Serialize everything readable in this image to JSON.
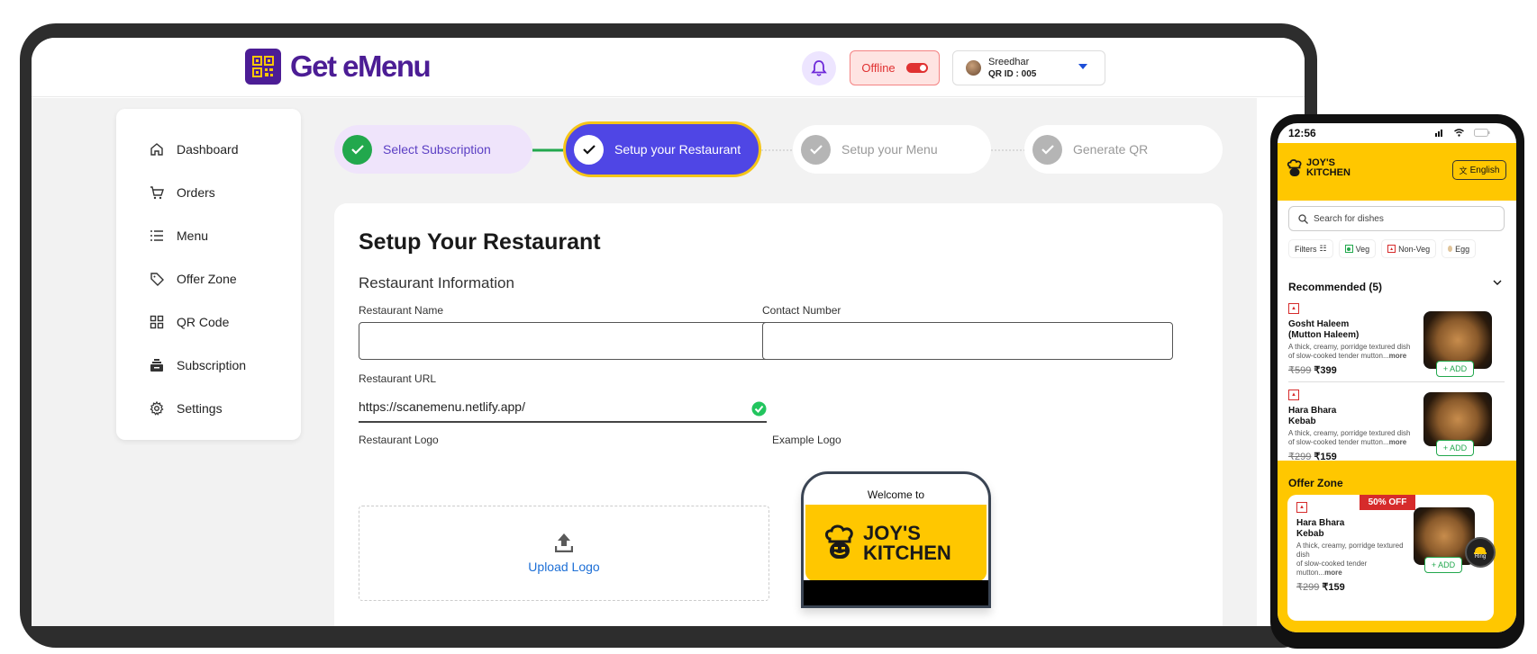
{
  "app": {
    "title": "Get eMenu"
  },
  "header": {
    "status_label": "Offline",
    "user_name": "Sreedhar",
    "user_qr": "QR ID : 005"
  },
  "sidebar": {
    "items": [
      {
        "label": "Dashboard",
        "icon": "home-icon"
      },
      {
        "label": "Orders",
        "icon": "cart-icon"
      },
      {
        "label": "Menu",
        "icon": "list-icon"
      },
      {
        "label": "Offer Zone",
        "icon": "tag-icon"
      },
      {
        "label": "QR Code",
        "icon": "grid-icon"
      },
      {
        "label": "Subscription",
        "icon": "subscription-icon"
      },
      {
        "label": "Settings",
        "icon": "gear-icon"
      }
    ]
  },
  "steps": [
    {
      "label": "Select Subscription",
      "state": "done"
    },
    {
      "label": "Setup your Restaurant",
      "state": "active"
    },
    {
      "label": "Setup your Menu",
      "state": "pending"
    },
    {
      "label": "Generate QR",
      "state": "pending"
    }
  ],
  "form": {
    "title": "Setup Your Restaurant",
    "section": "Restaurant Information",
    "name_label": "Restaurant Name",
    "name_value": "",
    "contact_label": "Contact Number",
    "contact_value": "",
    "url_label": "Restaurant URL",
    "url_value": "https://scanemenu.netlify.app/",
    "logo_label": "Restaurant Logo",
    "upload_label": "Upload Logo",
    "example_label": "Example Logo",
    "example_welcome": "Welcome to",
    "example_name_1": "JOY'S",
    "example_name_2": "KITCHEN"
  },
  "phone": {
    "time": "12:56",
    "brand_1": "JOY'S",
    "brand_2": "KITCHEN",
    "language": "English",
    "search_placeholder": "Search for dishes",
    "filters": [
      "Filters",
      "Veg",
      "Non-Veg",
      "Egg"
    ],
    "recommended": "Recommended (5)",
    "dishes": [
      {
        "name_1": "Gosht Haleem",
        "name_2": "(Mutton Haleem)",
        "desc_1": "A thick, creamy, porridge textured dish",
        "desc_2": "of slow-cooked tender mutton...",
        "more": "more",
        "old_price": "₹599",
        "price": "₹399",
        "add": "+ ADD"
      },
      {
        "name_1": "Hara Bhara",
        "name_2": "Kebab",
        "desc_1": "A thick, creamy, porridge textured dish",
        "desc_2": "of slow-cooked tender mutton...",
        "more": "more",
        "old_price": "₹299",
        "price": "₹159",
        "add": "+ ADD"
      }
    ],
    "offer_title": "Offer Zone",
    "offer": {
      "badge": "50% OFF",
      "name_1": "Hara Bhara",
      "name_2": "Kebab",
      "desc_1": "A thick, creamy, porridge textured dish",
      "desc_2": "of slow-cooked tender mutton...",
      "more": "more",
      "old_price": "₹299",
      "price": "₹159",
      "add": "+ ADD"
    },
    "ring_label": "Ring"
  },
  "colors": {
    "brand": "#4c1d95",
    "accent": "#4f46e5",
    "success": "#22a84d",
    "yellow": "#ffc700",
    "danger": "#e03131"
  }
}
